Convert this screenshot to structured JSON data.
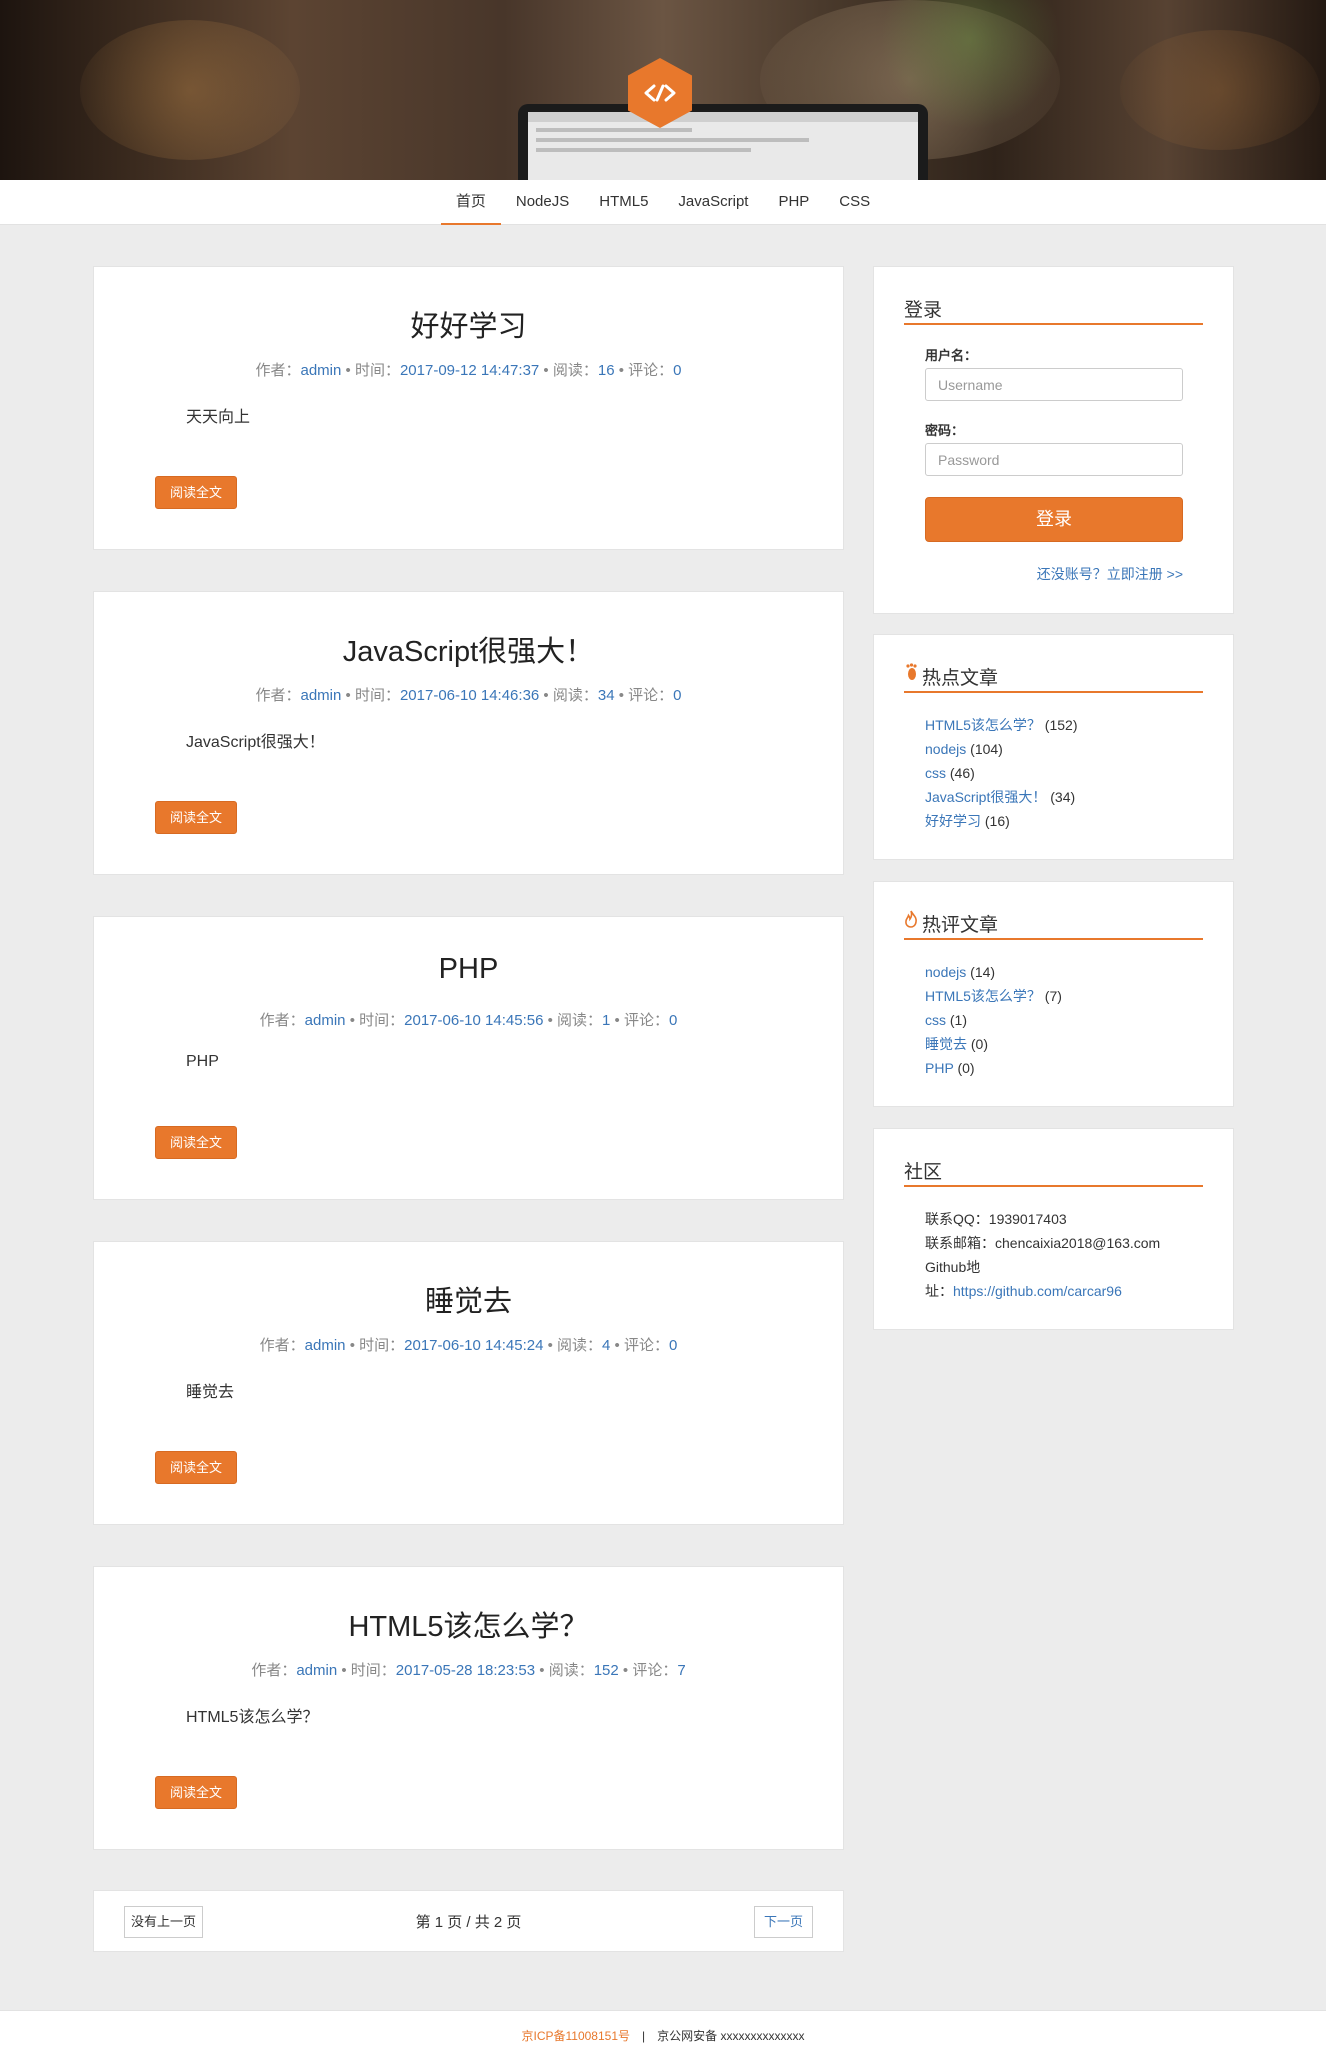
{
  "nav": {
    "items": [
      {
        "label": "首页",
        "active": true
      },
      {
        "label": "NodeJS"
      },
      {
        "label": "HTML5"
      },
      {
        "label": "JavaScript"
      },
      {
        "label": "PHP"
      },
      {
        "label": "CSS"
      }
    ]
  },
  "labels": {
    "author": "作者：",
    "time": "时间：",
    "views": "阅读：",
    "comments": "评论：",
    "dot": " • "
  },
  "posts": [
    {
      "title": "好好学习",
      "author": "admin",
      "time": "2017-09-12 14:47:37",
      "views": "16",
      "comments": "0",
      "excerpt": "天天向上",
      "button": "阅读全文"
    },
    {
      "title": "JavaScript很强大！",
      "author": "admin",
      "time": "2017-06-10 14:46:36",
      "views": "34",
      "comments": "0",
      "excerpt": "JavaScript很强大！",
      "button": "阅读全文"
    },
    {
      "title": "PHP",
      "author": "admin",
      "time": "2017-06-10 14:45:56",
      "views": "1",
      "comments": "0",
      "excerpt": "PHP",
      "button": "阅读全文"
    },
    {
      "title": "睡觉去",
      "author": "admin",
      "time": "2017-06-10 14:45:24",
      "views": "4",
      "comments": "0",
      "excerpt": "睡觉去",
      "button": "阅读全文"
    },
    {
      "title": "HTML5该怎么学？",
      "author": "admin",
      "time": "2017-05-28 18:23:53",
      "views": "152",
      "comments": "7",
      "excerpt": "HTML5该怎么学？",
      "button": "阅读全文"
    }
  ],
  "pager": {
    "prev": "没有上一页",
    "info": "第 1 页 / 共 2 页",
    "next": "下一页"
  },
  "login": {
    "title": "登录",
    "username_label": "用户名：",
    "username_placeholder": "Username",
    "password_label": "密码：",
    "password_placeholder": "Password",
    "button": "登录",
    "register": "还没账号？立即注册 >>"
  },
  "hot_views": {
    "title": "热点文章",
    "icon": "foot-icon",
    "items": [
      {
        "title": "HTML5该怎么学？",
        "count": "(152)"
      },
      {
        "title": "nodejs",
        "count": "(104)"
      },
      {
        "title": "css",
        "count": "(46)"
      },
      {
        "title": "JavaScript很强大！",
        "count": "(34)"
      },
      {
        "title": "好好学习",
        "count": "(16)"
      }
    ]
  },
  "hot_comments": {
    "title": "热评文章",
    "icon": "fire-icon",
    "items": [
      {
        "title": "nodejs",
        "count": "(14)"
      },
      {
        "title": "HTML5该怎么学？",
        "count": "(7)"
      },
      {
        "title": "css",
        "count": "(1)"
      },
      {
        "title": "睡觉去",
        "count": "(0)"
      },
      {
        "title": "PHP",
        "count": "(0)"
      }
    ]
  },
  "community": {
    "title": "社区",
    "qq": "联系QQ：1939017403",
    "email": "联系邮箱：chencaixia2018@163.com",
    "github_prefix_1": "Github地",
    "github_prefix_2": "址：",
    "github_url": "https://github.com/carcar96"
  },
  "footer": {
    "icp": "京ICP备11008151号",
    "sep": "|",
    "police": "京公网安备 xxxxxxxxxxxxxx"
  },
  "colors": {
    "accent": "#e8782c",
    "link": "#3a76b8",
    "background": "#ececec"
  }
}
